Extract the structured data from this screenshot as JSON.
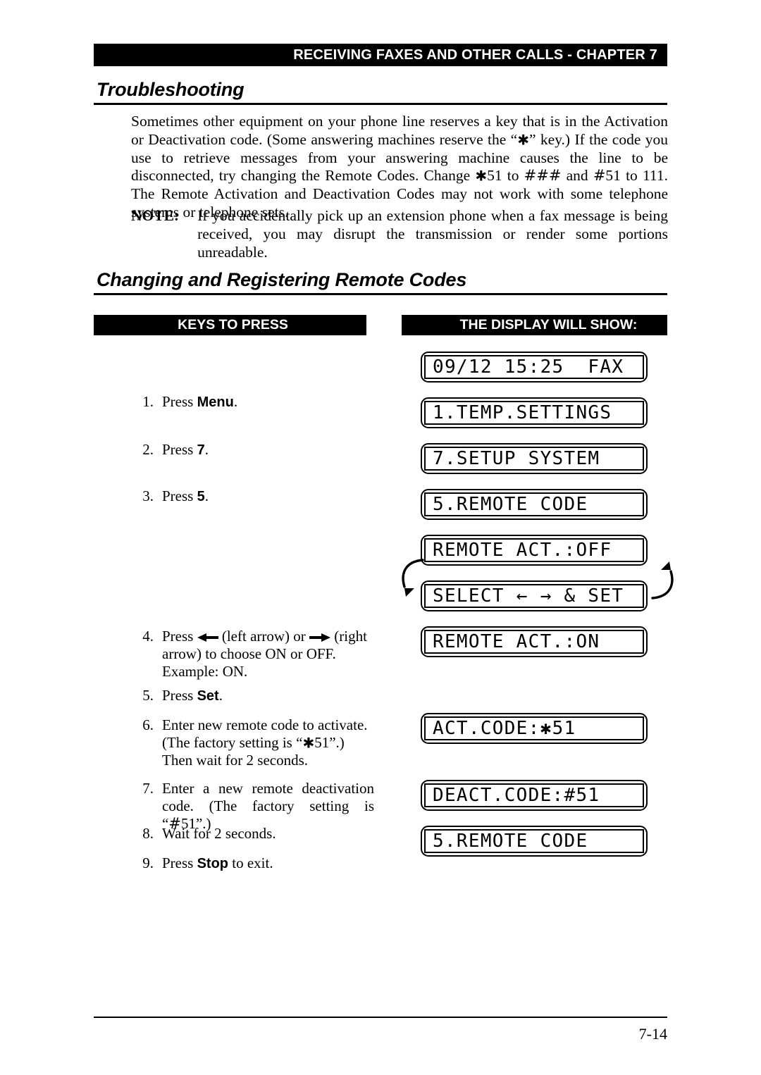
{
  "running_head": {
    "text": "RECEIVING FAXES AND OTHER CALLS - CHAPTER 7"
  },
  "sections": {
    "troubleshooting": {
      "heading": "Troubleshooting",
      "paragraph_part1": "Sometimes other equipment on your phone line reserves a key that is in the Activation or Deactivation code. (Some answering machines reserve the “",
      "paragraph_sym1": "✱",
      "paragraph_part2": "” key.) If the code you use to retrieve messages from your answering machine causes the line to be disconnected, try changing the Remote Codes. Change ",
      "paragraph_sym2": "✱",
      "paragraph_part3": "51 to ",
      "paragraph_sym3": "###",
      "paragraph_part4": " and ",
      "paragraph_sym4": "#",
      "paragraph_part5": "51 to 111. The Remote Activation and Deactivation Codes may not work with some telephone systems or telephone sets.",
      "note_label": "NOTE:",
      "note_text": "If you accidentally pick up an extension phone when a fax message is being received, you may disrupt the transmission or render some portions unreadable."
    },
    "remote_codes": {
      "heading": "Changing and Registering Remote Codes",
      "column_headers": {
        "keys": "KEYS TO PRESS",
        "display": "THE DISPLAY WILL SHOW:"
      }
    }
  },
  "steps": [
    {
      "number": "1.",
      "prefix": "Press ",
      "key": "Menu",
      "suffix": "."
    },
    {
      "number": "2.",
      "prefix": "Press ",
      "key": "7",
      "suffix": "."
    },
    {
      "number": "3.",
      "prefix": "Press ",
      "key": "5",
      "suffix": "."
    },
    {
      "number": "4.",
      "prefix": "Press ",
      "arrow_left_label": " (left arrow) or ",
      "arrow_right_label": " (right arrow) to choose ON or OFF. Example: ON.",
      "icon_left": "left-arrow-icon",
      "icon_right": "right-arrow-icon"
    },
    {
      "number": "5.",
      "prefix": "Press ",
      "key": "Set",
      "suffix": "."
    },
    {
      "number": "6.",
      "text_part1": "Enter new remote code to activate. (The factory setting is “",
      "text_sym": "✱",
      "text_part2": "51”.) Then wait for 2 seconds."
    },
    {
      "number": "7.",
      "text_part1": "Enter a new remote deactivation code. (The factory setting is “",
      "text_sym": "#",
      "text_part2": "51”.)"
    },
    {
      "number": "8.",
      "text": "Wait for 2 seconds."
    },
    {
      "number": "9.",
      "prefix": "Press ",
      "key": "Stop",
      "suffix": " to exit."
    }
  ],
  "displays": [
    {
      "id": "display-datetime",
      "text": "09/12 15:25  FAX"
    },
    {
      "id": "display-temp-settings",
      "text": "1.TEMP.SETTINGS"
    },
    {
      "id": "display-setup-system",
      "text": "7.SETUP SYSTEM"
    },
    {
      "id": "display-remote-code",
      "text": "5.REMOTE CODE"
    },
    {
      "id": "display-remote-act-off",
      "text": "REMOTE ACT.:OFF"
    },
    {
      "id": "display-select-and-set",
      "text": "SELECT ← → & SET"
    },
    {
      "id": "display-remote-act-on",
      "text": "REMOTE ACT.:ON"
    },
    {
      "id": "display-act-code",
      "prefix": "ACT.CODE:",
      "cursor": "✱",
      "suffix": "51"
    },
    {
      "id": "display-deact-code",
      "prefix": "DEACT.CODE:",
      "cursor": "#",
      "suffix": "51"
    },
    {
      "id": "display-remote-code-2",
      "text": "5.REMOTE CODE"
    }
  ],
  "footer": {
    "page_number": "7-14"
  }
}
